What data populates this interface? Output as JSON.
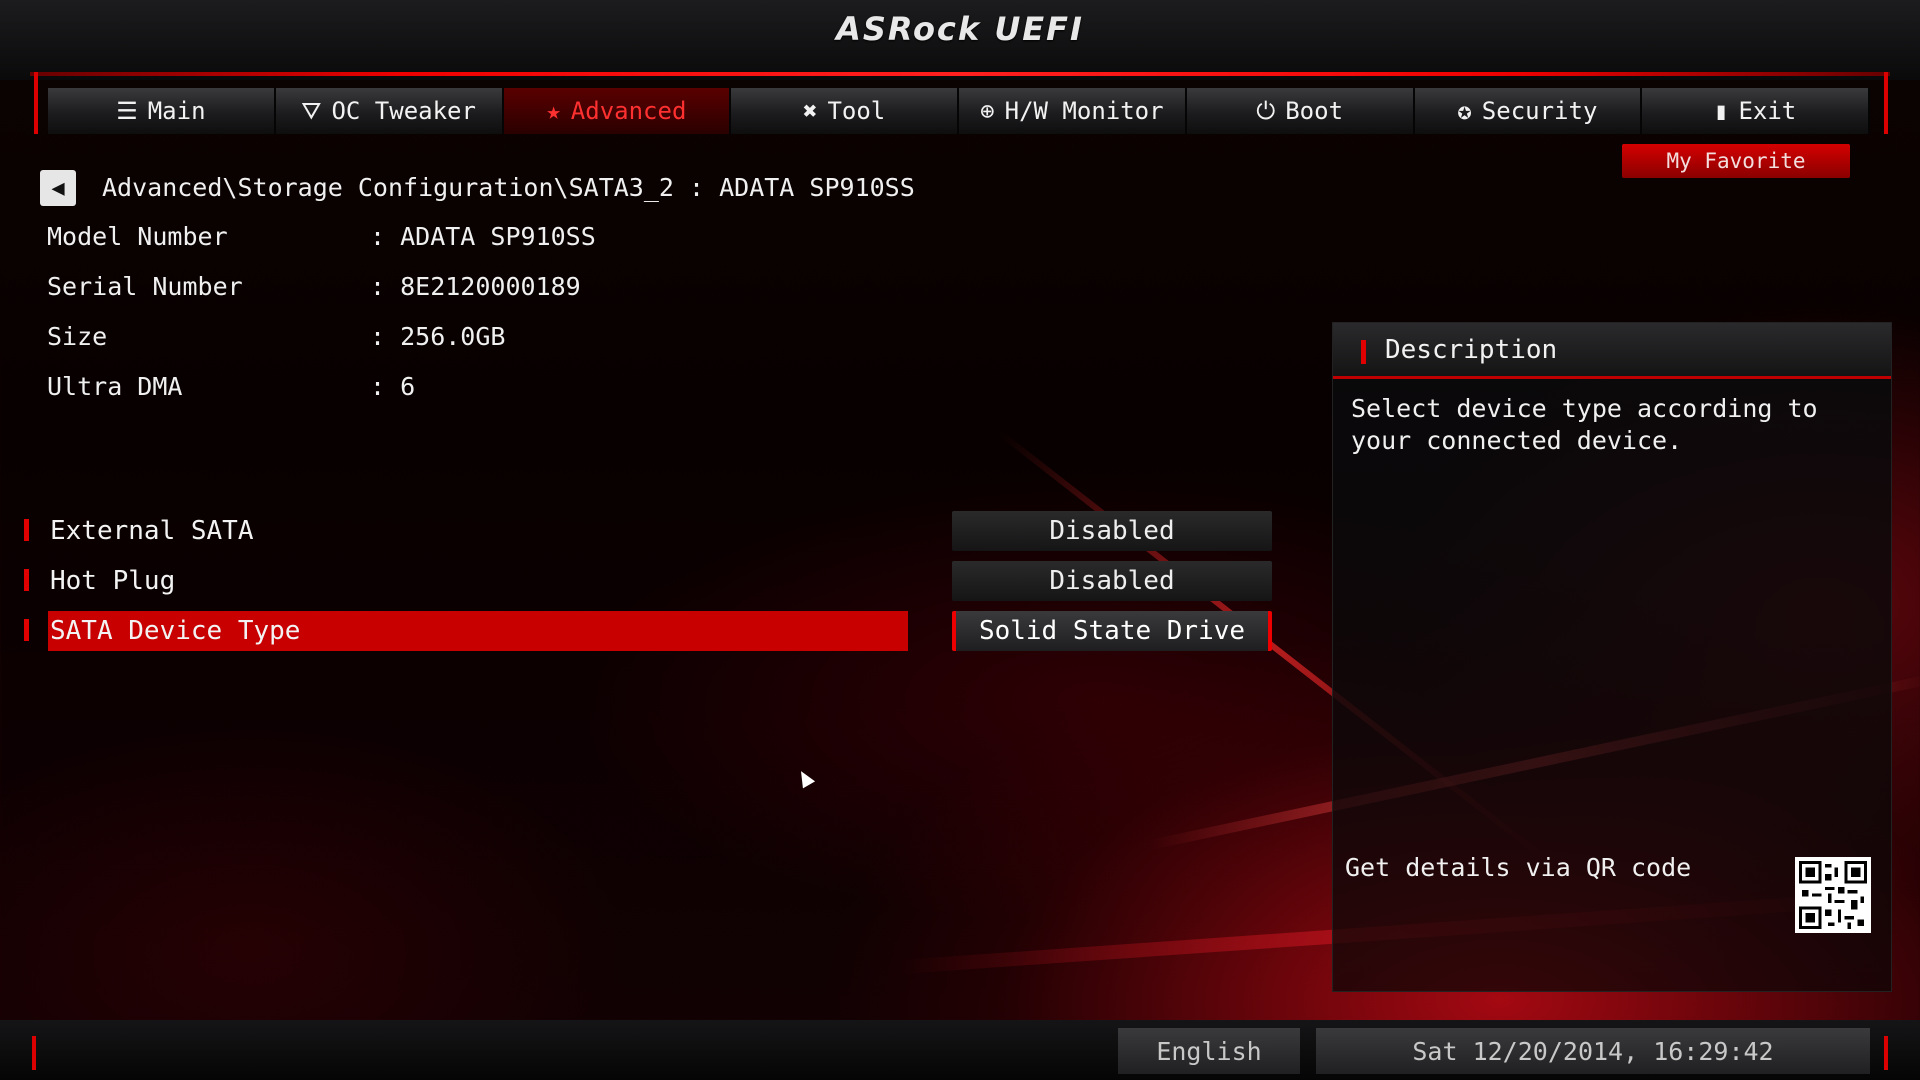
{
  "header": {
    "logo": "ASRock UEFI"
  },
  "tabs": [
    {
      "label": "Main",
      "icon": "list-icon",
      "glyph": "☰"
    },
    {
      "label": "OC Tweaker",
      "icon": "rocket-icon",
      "glyph": "⛛"
    },
    {
      "label": "Advanced",
      "icon": "star-icon",
      "glyph": "★",
      "active": true
    },
    {
      "label": "Tool",
      "icon": "tools-icon",
      "glyph": "✖"
    },
    {
      "label": "H/W Monitor",
      "icon": "crosshair-icon",
      "glyph": "⊕"
    },
    {
      "label": "Boot",
      "icon": "power-icon",
      "glyph": "⏻"
    },
    {
      "label": "Security",
      "icon": "shield-icon",
      "glyph": "✪"
    },
    {
      "label": "Exit",
      "icon": "door-icon",
      "glyph": "▮"
    }
  ],
  "favorite": {
    "label": "My Favorite"
  },
  "breadcrumb": {
    "back_glyph": "◀",
    "path": "Advanced\\Storage Configuration\\SATA3_2 : ADATA SP910SS"
  },
  "info": [
    {
      "label": "Model Number",
      "value": ": ADATA SP910SS"
    },
    {
      "label": "Serial Number",
      "value": ": 8E2120000189"
    },
    {
      "label": "Size",
      "value": ": 256.0GB"
    },
    {
      "label": "Ultra DMA",
      "value": ": 6"
    }
  ],
  "options": [
    {
      "label": "External SATA",
      "value": "Disabled"
    },
    {
      "label": "Hot Plug",
      "value": "Disabled"
    },
    {
      "label": "SATA Device Type",
      "value": "Solid State Drive",
      "selected": true
    }
  ],
  "description": {
    "title": "Description",
    "text": "Select device type according to your connected device.",
    "qr_text": "Get details via QR code"
  },
  "footer": {
    "language": "English",
    "datetime": "Sat 12/20/2014, 16:29:42"
  },
  "colors": {
    "accent": "#c80000",
    "background": "#0a0000"
  }
}
